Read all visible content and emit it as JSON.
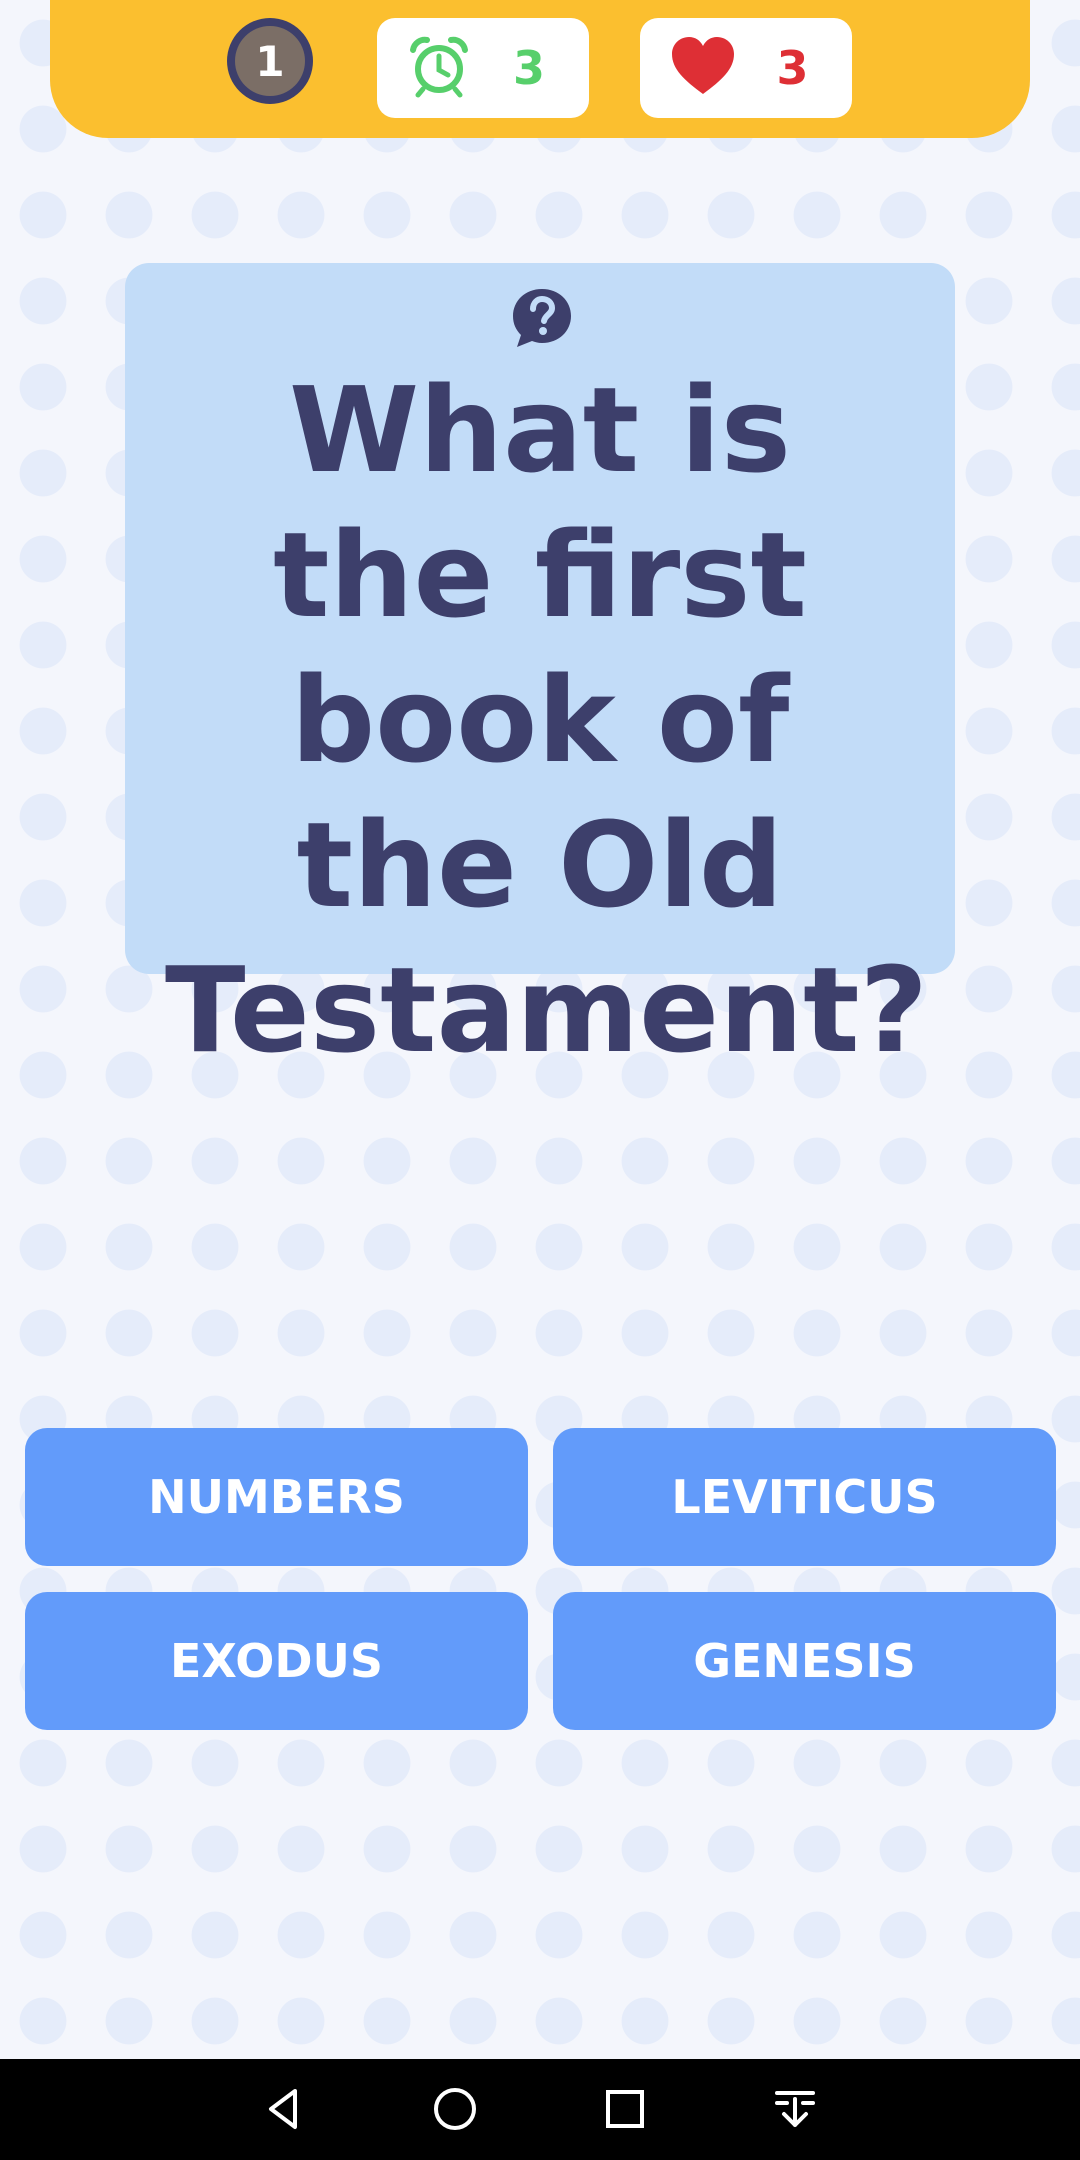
{
  "header": {
    "level": "1",
    "timer": {
      "icon": "alarm-clock-icon",
      "value": "3"
    },
    "lives": {
      "icon": "heart-icon",
      "value": "3"
    }
  },
  "question": {
    "icon": "question-bubble-icon",
    "text": "What is the first book of the Old Testament?"
  },
  "answers": [
    {
      "label": "NUMBERS"
    },
    {
      "label": "LEVITICUS"
    },
    {
      "label": "EXODUS"
    },
    {
      "label": "GENESIS"
    }
  ],
  "nav": {
    "buttons": [
      "back-icon",
      "home-icon",
      "recents-icon",
      "notifications-pull-icon"
    ]
  },
  "colors": {
    "header": "#fbbf2f",
    "question_card": "#c2dcf8",
    "question_text": "#3d3f6b",
    "answer_button": "#629bfa",
    "timer": "#57cf6b",
    "lives": "#de2f35"
  }
}
